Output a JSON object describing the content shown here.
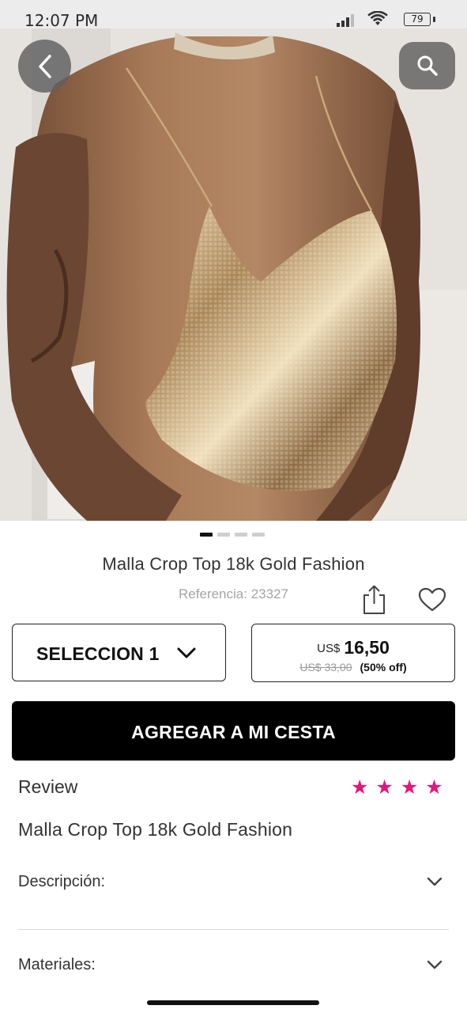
{
  "status_bar": {
    "time": "12:07 PM",
    "battery": "79"
  },
  "gallery": {
    "image_alt": "Gold mesh crop top on model",
    "page_count": 4,
    "active_page": 1
  },
  "product": {
    "title": "Malla Crop Top 18k Gold Fashion",
    "reference": "Referencia: 23327"
  },
  "variant_select": {
    "selected": "SELECCION 1"
  },
  "price": {
    "currency": "US$",
    "current": "16,50",
    "old": "US$ 33,00",
    "discount": "(50% off)"
  },
  "actions": {
    "add_to_cart": "AGREGAR A MI CESTA"
  },
  "review": {
    "label": "Review",
    "stars": 4,
    "star_color": "#e6157d"
  },
  "details": {
    "name": "Malla Crop Top 18k Gold Fashion",
    "sections": [
      {
        "label": "Descripción:"
      },
      {
        "label": "Materiales:"
      }
    ]
  }
}
